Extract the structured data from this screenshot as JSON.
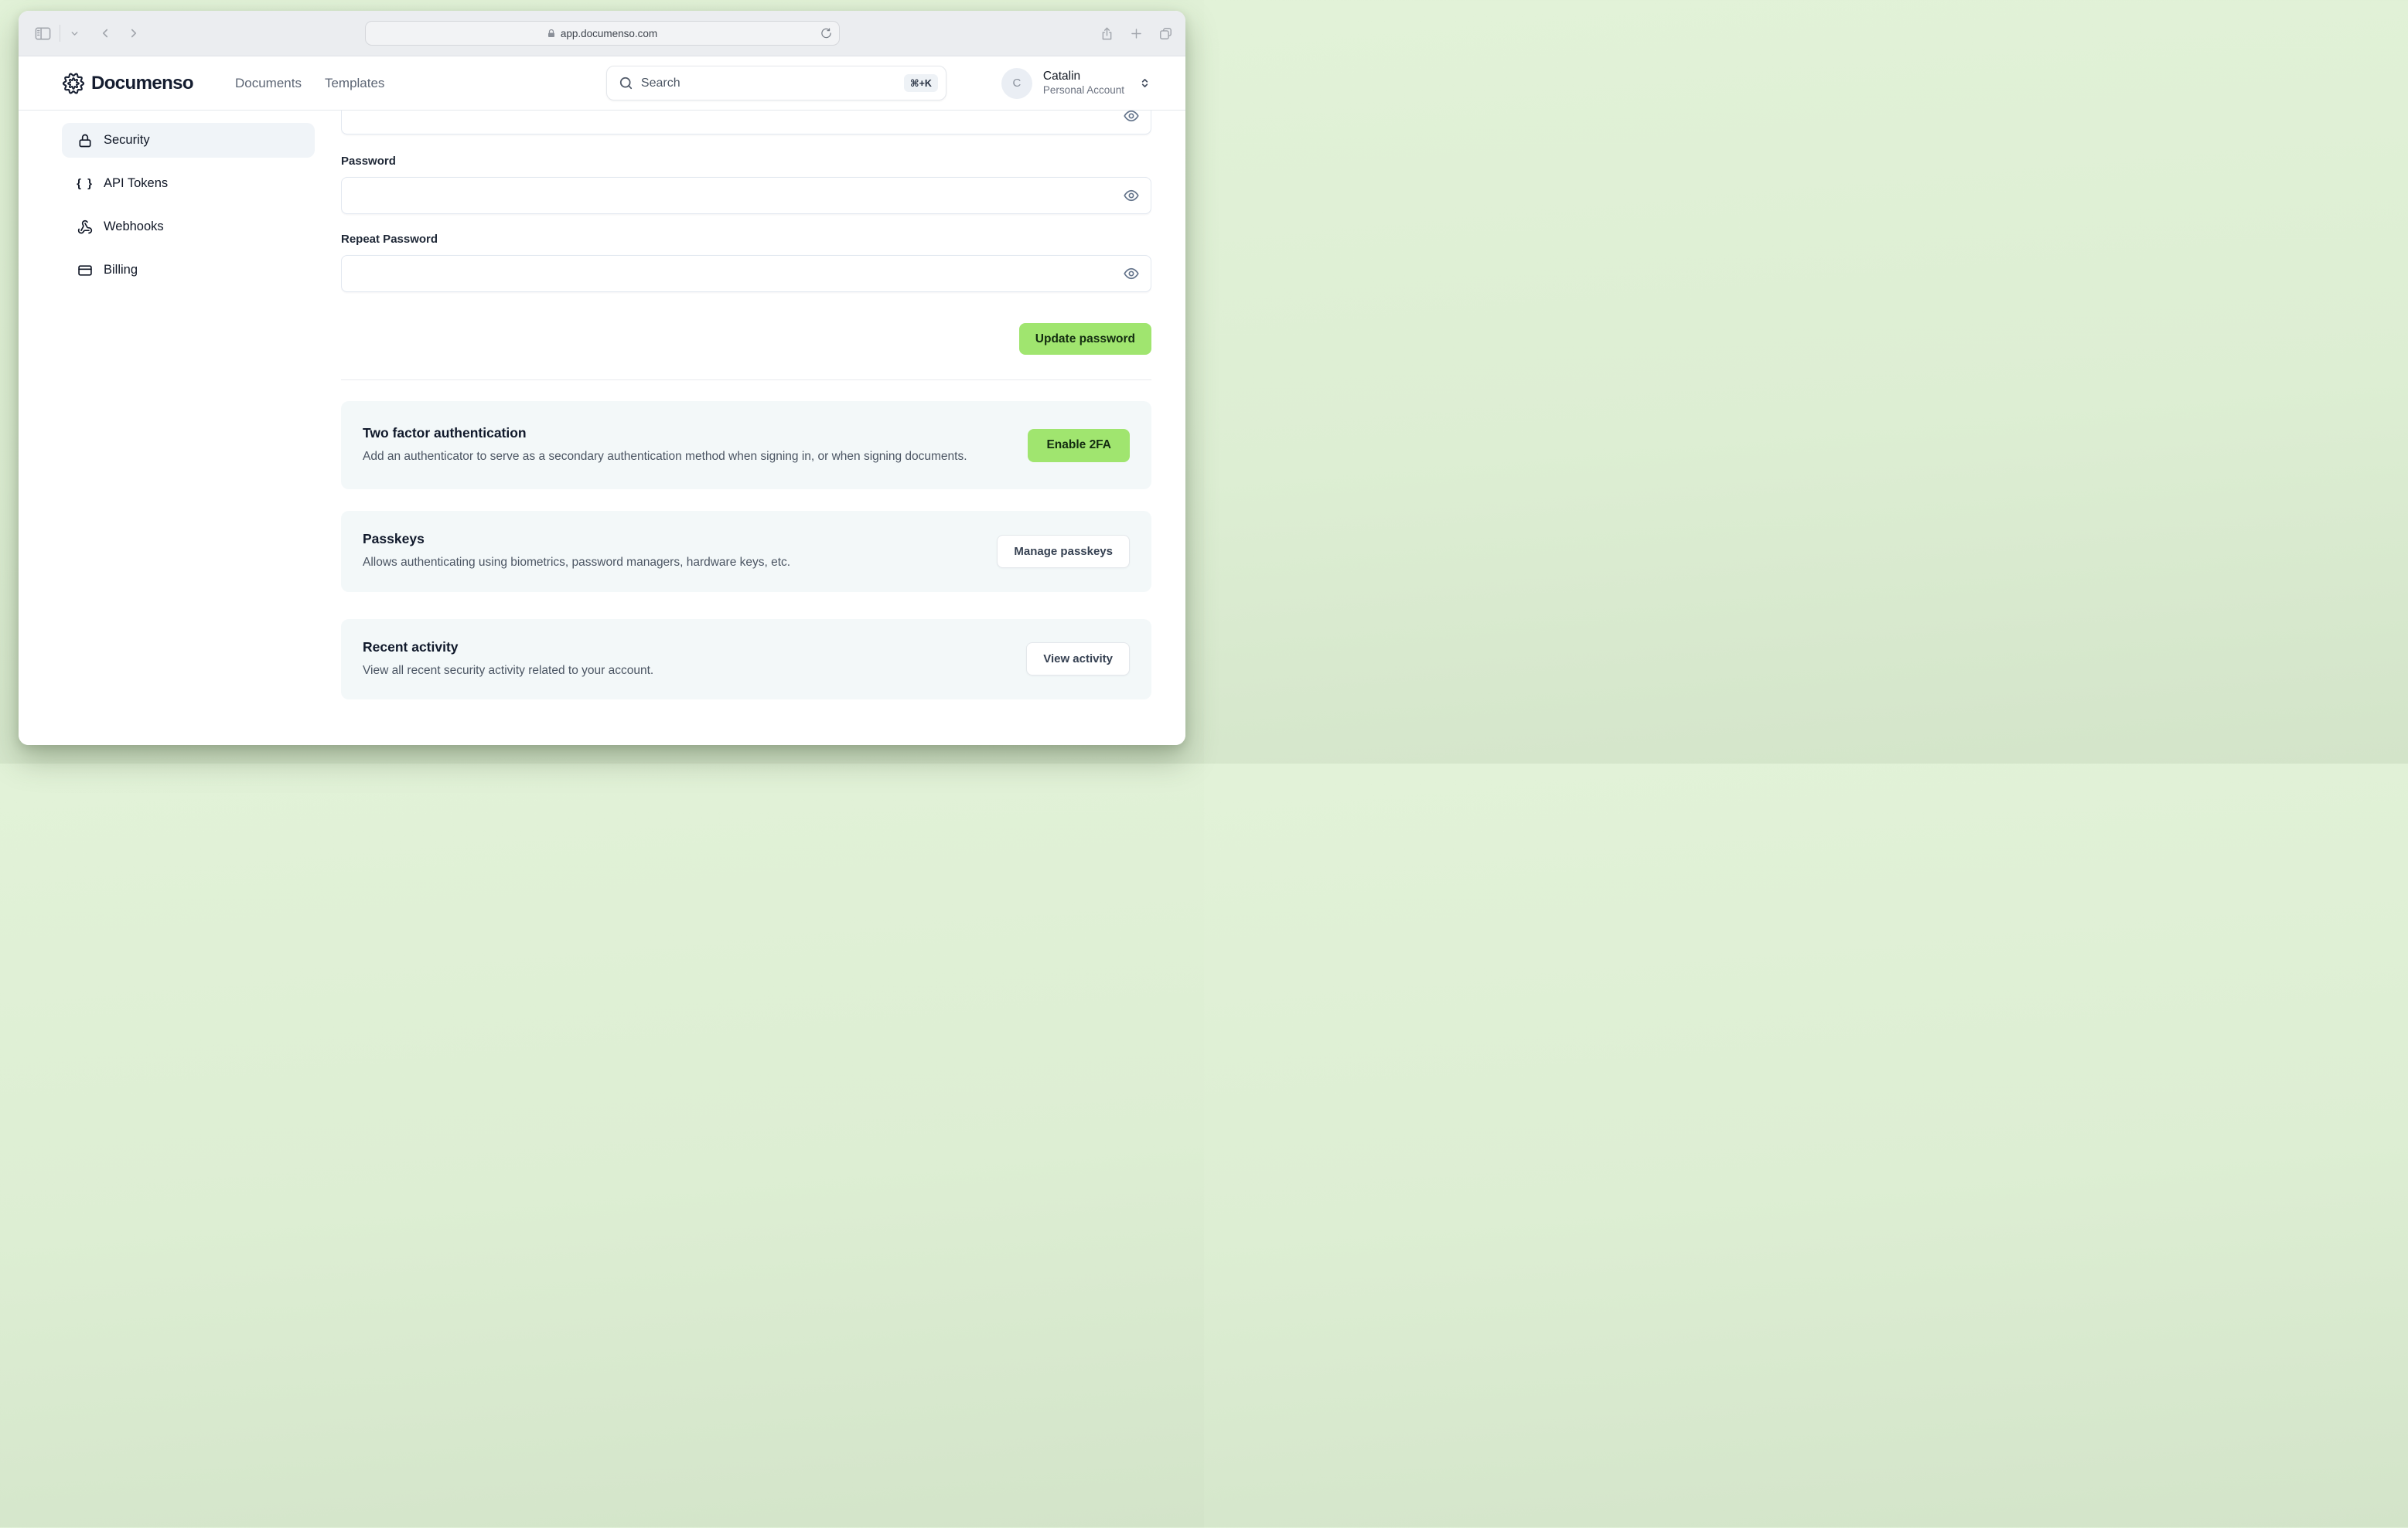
{
  "browser": {
    "url": "app.documenso.com"
  },
  "header": {
    "brand": "Documenso",
    "nav": [
      {
        "label": "Documents"
      },
      {
        "label": "Templates"
      }
    ],
    "search": {
      "placeholder": "Search",
      "shortcut": "⌘+K"
    },
    "account": {
      "initial": "C",
      "name": "Catalin",
      "type": "Personal Account"
    }
  },
  "sidebar": {
    "items": [
      {
        "label": "Security"
      },
      {
        "label": "API Tokens"
      },
      {
        "label": "Webhooks"
      },
      {
        "label": "Billing"
      }
    ]
  },
  "password_form": {
    "password_label": "Password",
    "repeat_label": "Repeat Password",
    "submit_label": "Update password"
  },
  "sections": {
    "two_factor": {
      "title": "Two factor authentication",
      "description": "Add an authenticator to serve as a secondary authentication method when signing in, or when signing documents.",
      "button": "Enable 2FA"
    },
    "passkeys": {
      "title": "Passkeys",
      "description": "Allows authenticating using biometrics, password managers, hardware keys, etc.",
      "button": "Manage passkeys"
    },
    "recent_activity": {
      "title": "Recent activity",
      "description": "View all recent security activity related to your account.",
      "button": "View activity"
    }
  },
  "icons": {
    "braces": "{ }"
  },
  "colors": {
    "accent_green": "#a0e56f",
    "accent_green_text": "#132c10",
    "card_bg": "#f3f8f9",
    "active_item_bg": "#f0f4f8"
  }
}
